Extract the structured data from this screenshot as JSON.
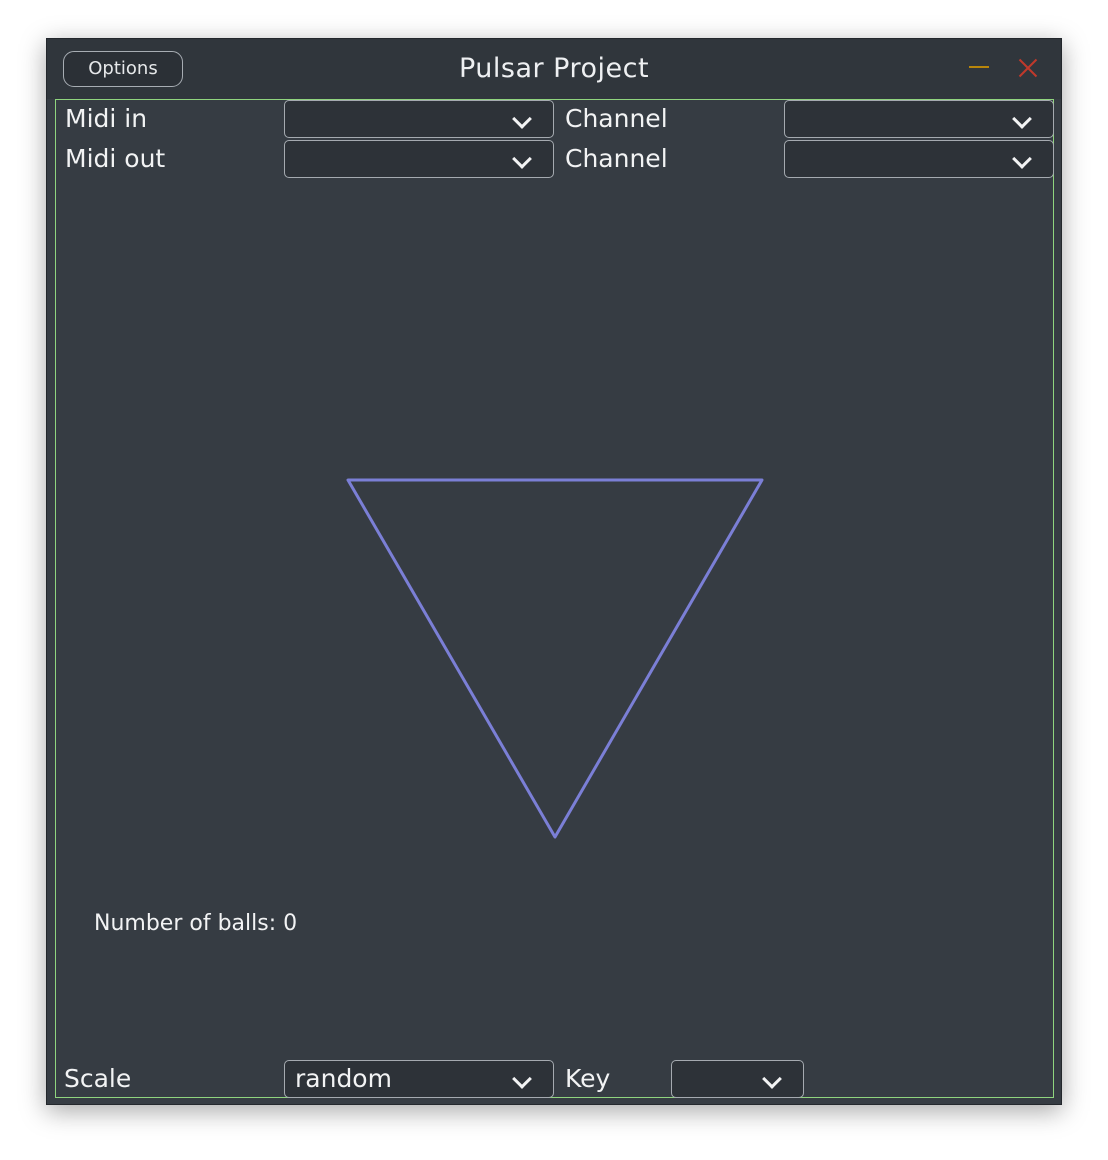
{
  "window": {
    "title": "Pulsar Project",
    "options_label": "Options",
    "border_accent": "#8fd47e"
  },
  "midi": {
    "in_label": "Midi in",
    "in_value": "",
    "in_channel_label": "Channel",
    "in_channel_value": "",
    "out_label": "Midi out",
    "out_value": "",
    "out_channel_label": "Channel",
    "out_channel_value": ""
  },
  "canvas": {
    "shape": "triangle",
    "stroke_color": "#7b7fd6",
    "balls_label": "Number of balls: 0"
  },
  "footer": {
    "scale_label": "Scale",
    "scale_value": "random",
    "key_label": "Key",
    "key_value": ""
  },
  "icons": [
    "minimize-icon",
    "close-icon",
    "chevron-down-icon"
  ]
}
